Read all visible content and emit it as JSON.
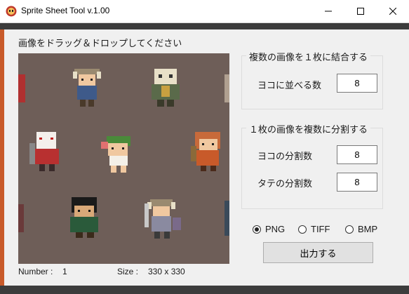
{
  "window": {
    "title": "Sprite Sheet Tool v.1.00"
  },
  "drop": {
    "instruction": "画像をドラッグ＆ドロップしてください"
  },
  "status": {
    "number_label": "Number :",
    "number_value": "1",
    "size_label": "Size :",
    "size_value": "330 x 330"
  },
  "combine": {
    "title": "複数の画像を１枚に結合する",
    "horizontal_label": "ヨコに並べる数",
    "horizontal_value": "8"
  },
  "split": {
    "title": "１枚の画像を複数に分割する",
    "horizontal_label": "ヨコの分割数",
    "horizontal_value": "8",
    "vertical_label": "タテの分割数",
    "vertical_value": "8"
  },
  "format": {
    "options": [
      "PNG",
      "TIFF",
      "BMP"
    ],
    "selected": "PNG"
  },
  "output_button": {
    "label": "出力する"
  },
  "colors": {
    "accent": "#c85a2a",
    "preview_bg": "#6e5e58",
    "client_bg": "#f0f0f0"
  },
  "preview": {
    "content": "pixel-art character sprite sheet"
  }
}
